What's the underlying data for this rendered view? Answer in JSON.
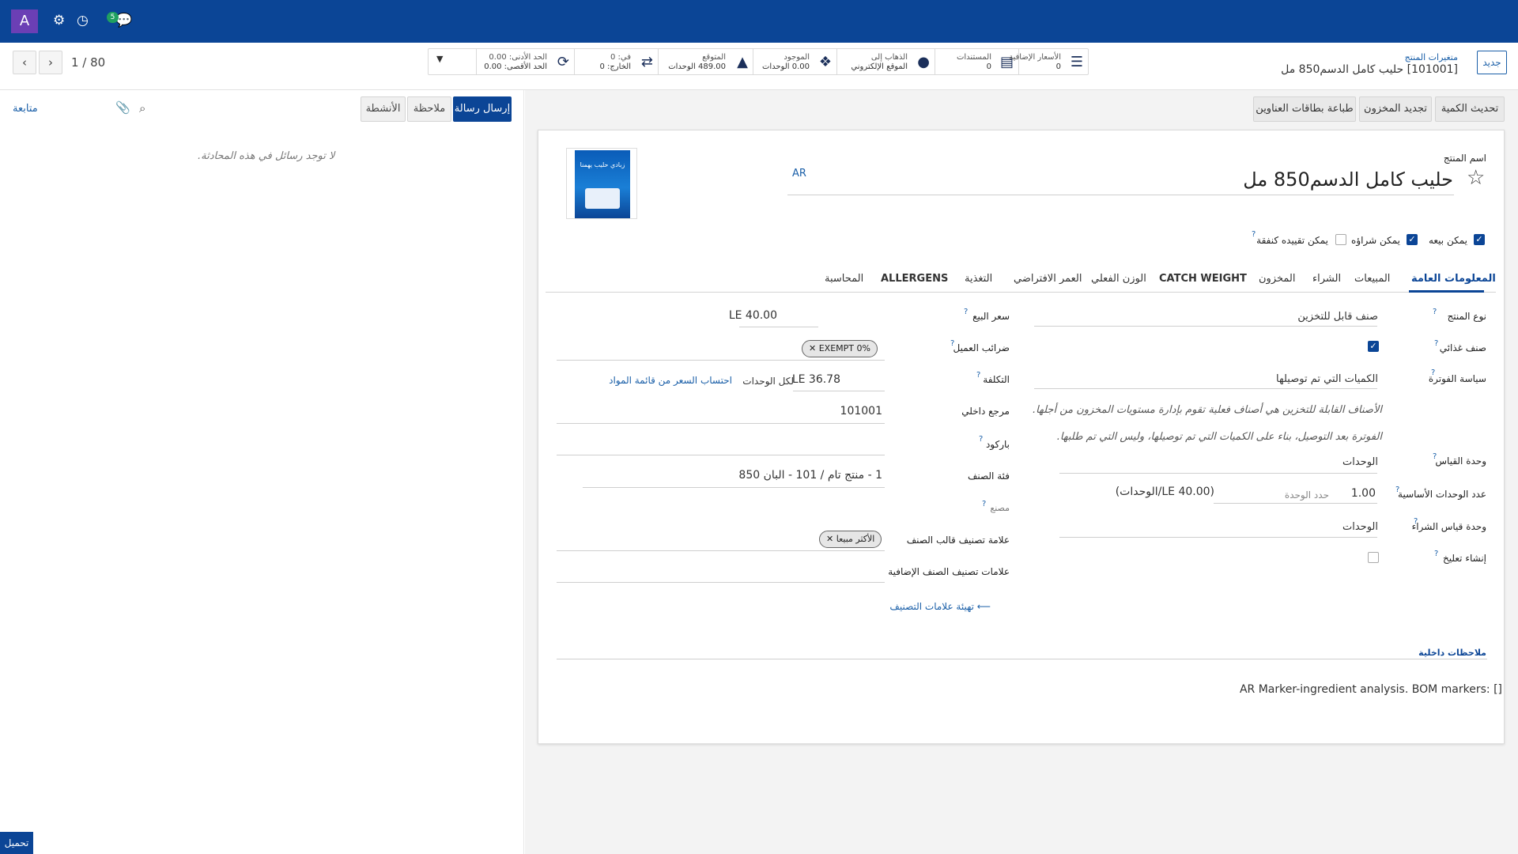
{
  "topbar": {
    "avatar": "A",
    "chat_badge": "5"
  },
  "pager": {
    "counter": "1 / 80"
  },
  "stats": [
    {
      "icon": "list-icon",
      "line1": "الأسعار الإضافية",
      "line2": "0"
    },
    {
      "icon": "document-icon",
      "line1": "المستندات",
      "line2": "0"
    },
    {
      "icon": "globe-icon",
      "line1": "الذهاب إلى",
      "line2": "الموقع الإلكتروني"
    },
    {
      "icon": "cubes-icon",
      "line1": "الموجود",
      "line2": "0.00 الوحدات"
    },
    {
      "icon": "area-chart-icon",
      "line1": "المتوقع",
      "line2": "489.00 الوحدات"
    },
    {
      "icon": "transfer-icon",
      "line1": "في: 0",
      "line2": "الخارج: 0"
    },
    {
      "icon": "refresh-icon",
      "line1": "الحد الأدنى: 0.00",
      "line2": "الحد الأقصى: 0.00"
    }
  ],
  "breadcrumb": {
    "parent": "متغيرات المنتج",
    "current": "[101001] حليب كامل الدسم850 مل"
  },
  "buttons": {
    "new": "جديد",
    "update_qty": "تحديث الكمية",
    "replenish": "تجديد المخزون",
    "print_labels": "طباعة بطاقات العناوين",
    "send_message": "إرسال رسالة",
    "log_note": "ملاحظة",
    "activities": "الأنشطة",
    "follow": "متابعة",
    "download": "تحميل"
  },
  "chatter": {
    "empty": "لا توجد رسائل في هذه المحادثة."
  },
  "product": {
    "name_label": "اسم المنتج",
    "name": "حليب كامل الدسم850 مل",
    "lang": "AR",
    "image_caption": "زبادي حليب يهمنا"
  },
  "options": [
    {
      "label": "يمكن بيعه",
      "checked": true
    },
    {
      "label": "يمكن شراؤه",
      "checked": true
    },
    {
      "label": "يمكن تقييده كنفقة",
      "checked": false
    }
  ],
  "tabs": [
    "المعلومات العامة",
    "المبيعات",
    "الشراء",
    "المخزون",
    "CATCH WEIGHT",
    "الوزن الفعلي",
    "العمر الافتراضي",
    "التغذية",
    "ALLERGENS",
    "المحاسبة"
  ],
  "general": {
    "type_label": "نوع المنتج",
    "type_value": "صنف قابل للتخزين",
    "food_label": "صنف غذائي",
    "invoice_policy_label": "سياسة الفوترة",
    "invoice_policy_value": "الكميات التي تم توصيلها",
    "hint1": "الأصناف القابلة للتخزين هي أصناف فعلية تقوم بإدارة مستويات المخزون من أجلها.",
    "hint2": "الفوترة بعد التوصيل، بناء على الكميات التي تم توصيلها، وليس التي تم طلبها.",
    "uom_label": "وحدة القياس",
    "uom_value": "الوحدات",
    "base_units_label": "عدد الوحدات الأساسية",
    "base_units_value": "1.00",
    "unit_limit": "حدد الوحدة",
    "unit_price": "(40.00 LE/الوحدات)",
    "purchase_uom_label": "وحدة قياس الشراء",
    "purchase_uom_value": "الوحدات",
    "create_repack_label": "إنشاء تعليخ",
    "sale_price_label": "سعر البيع",
    "sale_price_value": "LE 40.00",
    "customer_taxes_label": "ضرائب العميل",
    "customer_tax_tag": "EXEMPT 0%",
    "cost_label": "التكلفة",
    "cost_value": "LE 36.78",
    "cost_per": "لكل الوحدات",
    "compute_bom": "احتساب السعر من قائمة المواد",
    "internal_ref_label": "مرجع داخلي",
    "internal_ref_value": "101001",
    "barcode_label": "باركود",
    "category_label": "فئة الصنف",
    "category_value": "1 - منتج تام / 101 - البان 850",
    "manufacturer_label": "مصنع",
    "template_tags_label": "علامة تصنيف قالب الصنف",
    "template_tag": "الأكثر مبيعا",
    "extra_tags_label": "علامات تصنيف الصنف الإضافية",
    "config_tags": "تهيئة علامات التصنيف",
    "internal_notes_label": "ملاحظات داخلية",
    "marker_text": "AR Marker-ingredient analysis. BOM markers: []"
  },
  "colors": {
    "brand": "#0b4596",
    "link": "#1a5fa8",
    "avatar": "#6b3fb5",
    "badge": "#20a060"
  }
}
